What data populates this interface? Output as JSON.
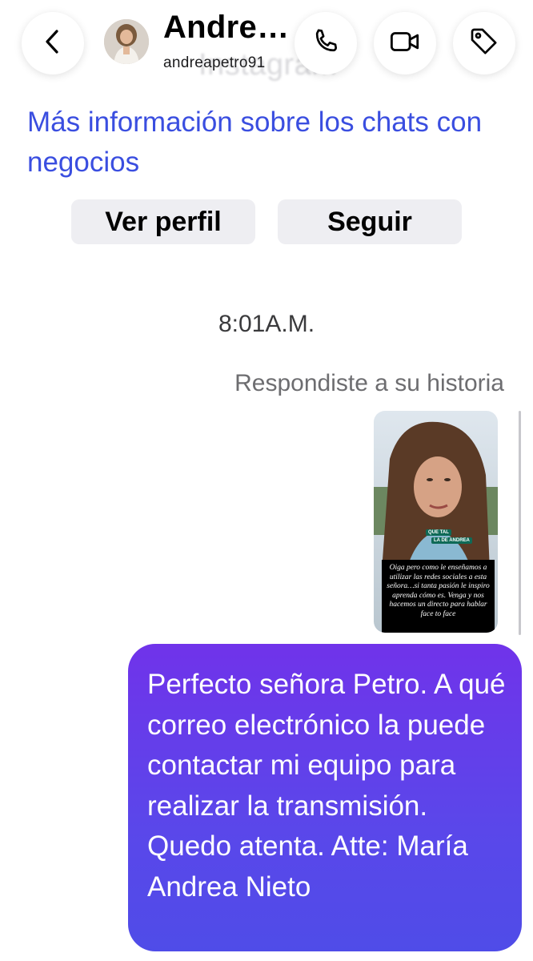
{
  "header": {
    "name": "Andre…",
    "handle": "andreapetro91",
    "ghost_text": "Instagram"
  },
  "info_link": "Más información sobre los chats con negocios",
  "actions": {
    "view_profile": "Ver perfil",
    "follow": "Seguir"
  },
  "conversation": {
    "timestamp": "8:01A.M.",
    "reply_context": "Respondiste a su historia",
    "story": {
      "label_1": "QUE TAL",
      "label_2": "LA DE ANDREA",
      "caption": "Oiga pero como le enseñamos a utilizar las redes sociales a esta señora…si tanta pasión le inspiro aprenda cómo es. Venga y nos hacemos un directo para hablar face to face"
    },
    "outgoing_message": "Perfecto señora Petro. A qué correo electrónico la puede contactar mi equipo para realizar la transmisión. Quedo atenta. Atte: María Andrea Nieto"
  },
  "icons": {
    "back": "chevron-left-icon",
    "call": "phone-icon",
    "video": "video-camera-icon",
    "tag": "tag-icon"
  },
  "colors": {
    "link": "#3a4ee0",
    "bubble_top": "#7033ea",
    "bubble_bottom": "#4f4ce8",
    "pill_bg": "#eeeef2"
  }
}
